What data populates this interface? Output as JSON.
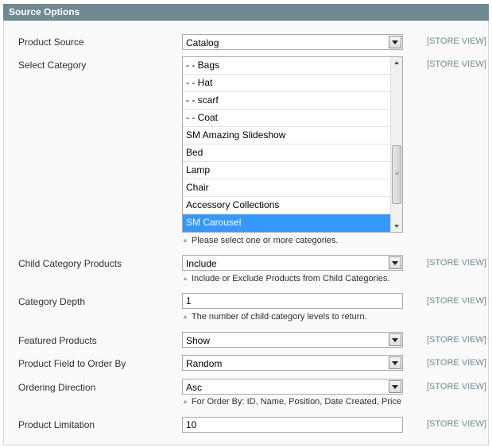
{
  "section": {
    "title": "Source Options"
  },
  "scope_label": "[STORE VIEW]",
  "fields": {
    "product_source": {
      "label": "Product Source",
      "value": "Catalog"
    },
    "select_category": {
      "label": "Select Category",
      "options": [
        "- - Bags",
        "- - Hat",
        "- - scarf",
        "- - Coat",
        "SM Amazing Slideshow",
        "Bed",
        "Lamp",
        "Chair",
        "Accessory Collections",
        "SM Carousel"
      ],
      "selected": "SM Carousel",
      "note": "Please select one or more categories."
    },
    "child_category_products": {
      "label": "Child Category Products",
      "value": "Include",
      "note": "Include or Exclude Products from Child Categories."
    },
    "category_depth": {
      "label": "Category Depth",
      "value": "1",
      "note": "The number of child category levels to return."
    },
    "featured_products": {
      "label": "Featured Products",
      "value": "Show"
    },
    "product_field_order": {
      "label": "Product Field to Order By",
      "value": "Random"
    },
    "ordering_direction": {
      "label": "Ordering Direction",
      "value": "Asc",
      "note": "For Order By: ID, Name, Position, Date Created, Price"
    },
    "product_limitation": {
      "label": "Product Limitation",
      "value": "10"
    }
  }
}
